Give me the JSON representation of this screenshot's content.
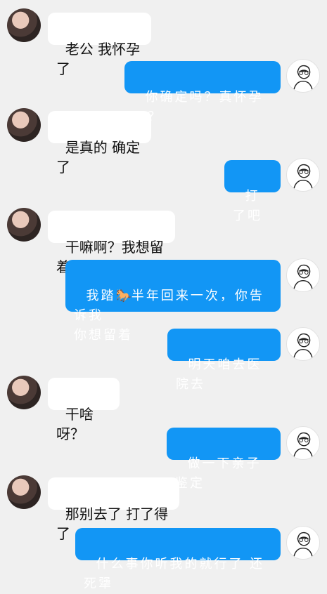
{
  "chat": {
    "messages": [
      {
        "side": "left",
        "avatar": "female-avatar",
        "text": "老公 我怀孕了"
      },
      {
        "side": "right",
        "avatar": "male-sketch-avatar",
        "text": "你确定吗？真怀孕了？"
      },
      {
        "side": "left",
        "avatar": "female-avatar",
        "text": "是真的 确定了"
      },
      {
        "side": "right",
        "avatar": "male-sketch-avatar",
        "text": "打了吧"
      },
      {
        "side": "left",
        "avatar": "female-avatar",
        "text": "干嘛啊？我想留着"
      },
      {
        "side": "right",
        "avatar": "male-sketch-avatar",
        "text_a": "我踏",
        "emoji": "🐎",
        "text_b": "半年回来一次，你告诉我\n你想留着"
      },
      {
        "side": "right",
        "avatar": "male-sketch-avatar",
        "text": "明天咱去医院去"
      },
      {
        "side": "left",
        "avatar": "female-avatar",
        "text": "干啥呀？"
      },
      {
        "side": "right",
        "avatar": "male-sketch-avatar",
        "text": "做一下亲子鉴定"
      },
      {
        "side": "left",
        "avatar": "female-avatar",
        "text": "那别去了 打了得了"
      },
      {
        "side": "right",
        "avatar": "male-sketch-avatar",
        "text": "什么事你听我的就行了 还死犟"
      }
    ]
  },
  "colors": {
    "background": "#f0f0f0",
    "left_bubble": "#ffffff",
    "right_bubble": "#1296f5"
  }
}
